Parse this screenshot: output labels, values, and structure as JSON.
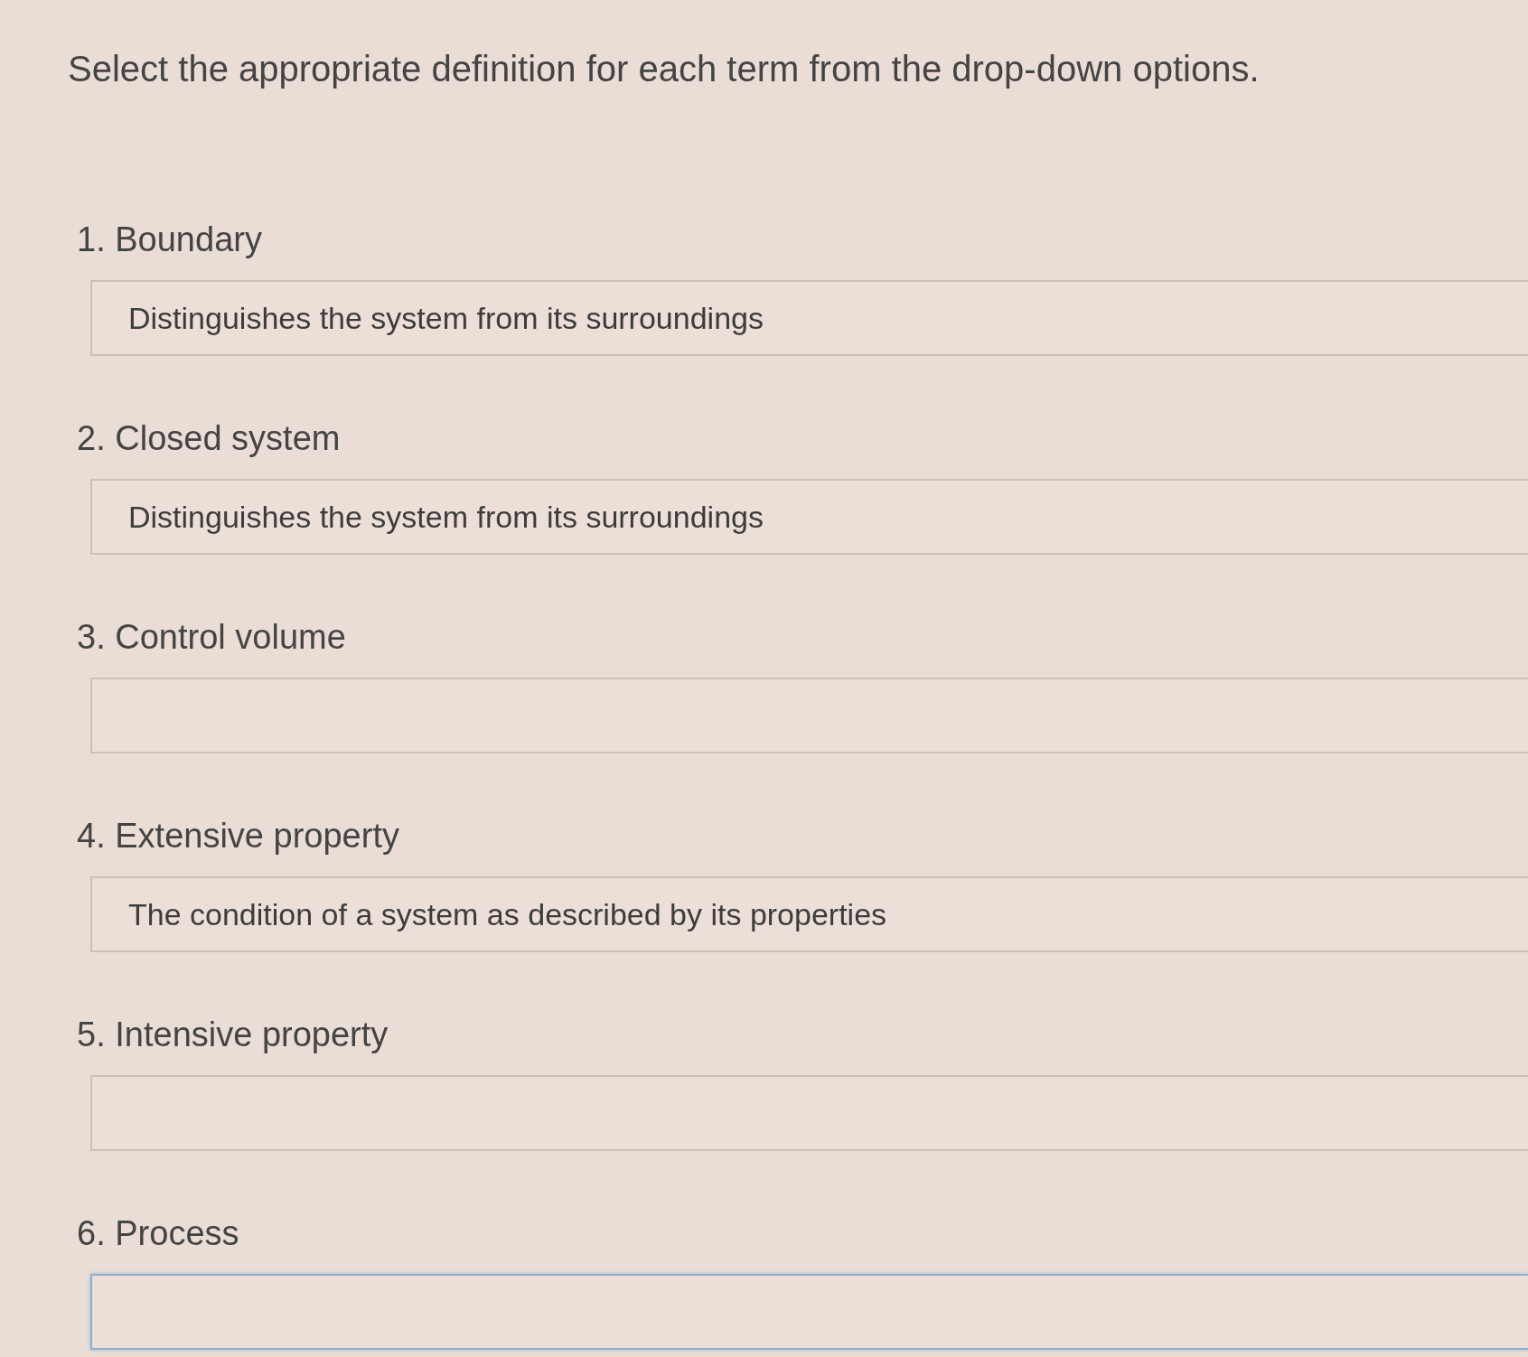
{
  "instruction": "Select the appropriate definition for each term from the drop-down options.",
  "questions": [
    {
      "label": "1. Boundary",
      "answer": "Distinguishes the system from its surroundings",
      "focused": false
    },
    {
      "label": "2. Closed system",
      "answer": "Distinguishes the system from its surroundings",
      "focused": false
    },
    {
      "label": "3. Control volume",
      "focused": false
    },
    {
      "label": "4. Extensive property",
      "answer": "The condition of a system as described by its properties",
      "focused": false
    },
    {
      "label": "5. Intensive property",
      "focused": false
    },
    {
      "label": "6. Process",
      "focused": true
    }
  ]
}
